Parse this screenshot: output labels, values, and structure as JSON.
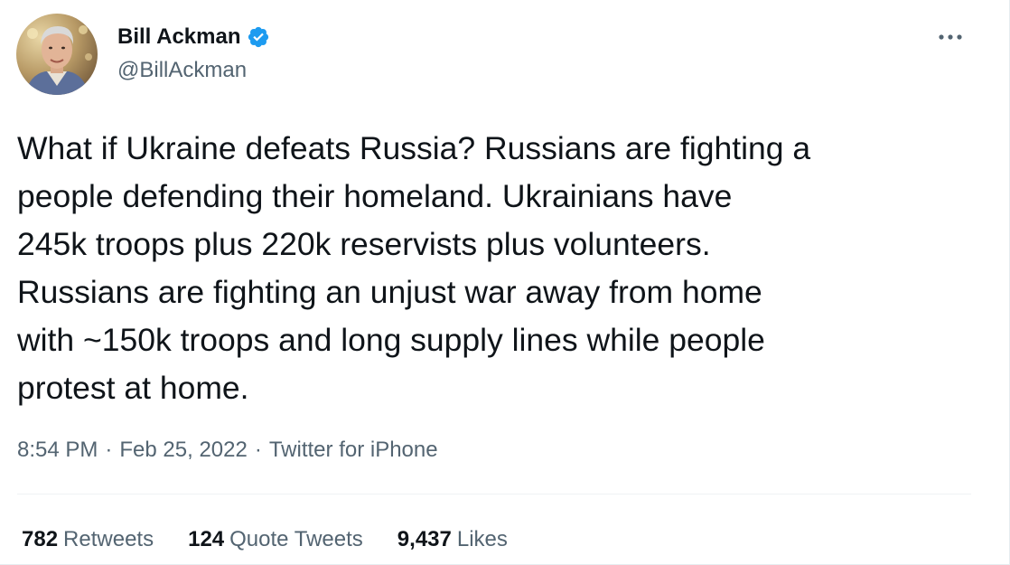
{
  "author": {
    "display_name": "Bill Ackman",
    "handle": "@BillAckman",
    "verified": true,
    "verified_color": "#1d9bf0"
  },
  "icons": {
    "avatar": "profile-photo",
    "verified": "verified-badge-icon",
    "more": "more-options-icon"
  },
  "tweet": {
    "text": "What if Ukraine defeats Russia? Russians are fighting a\npeople defending their homeland. Ukrainians have\n245k troops plus 220k reservists plus volunteers.\nRussians are fighting an unjust war away from home\nwith ~150k troops and long supply lines while people\nprotest at home."
  },
  "meta": {
    "time": "8:54 PM",
    "separator": "·",
    "date": "Feb 25, 2022",
    "source": "Twitter for iPhone"
  },
  "stats": {
    "retweets_count": "782",
    "retweets_label": "Retweets",
    "quotes_count": "124",
    "quotes_label": "Quote Tweets",
    "likes_count": "9,437",
    "likes_label": "Likes"
  },
  "colors": {
    "text_primary": "#0f1419",
    "text_secondary": "#536471",
    "divider": "#eff3f4"
  }
}
